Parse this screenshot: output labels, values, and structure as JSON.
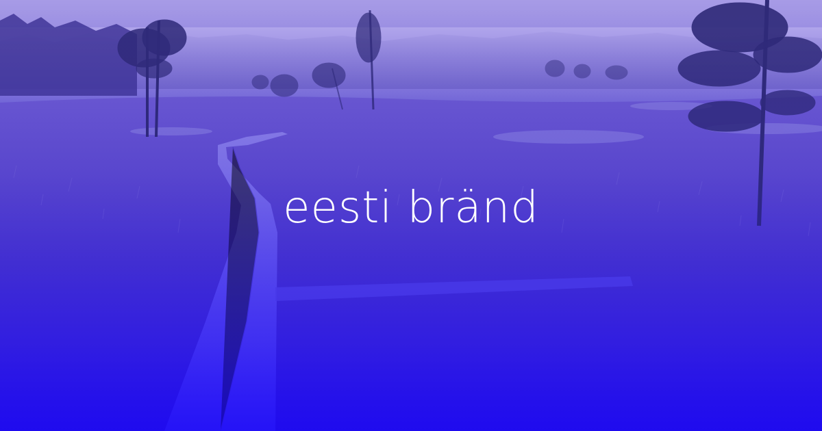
{
  "hero": {
    "title": "eesti bränd"
  },
  "colors": {
    "sky": "#a79be6",
    "bog": "#4f3dc9",
    "overlay_bottom": "#2614ea",
    "title_text": "#ffffff"
  }
}
